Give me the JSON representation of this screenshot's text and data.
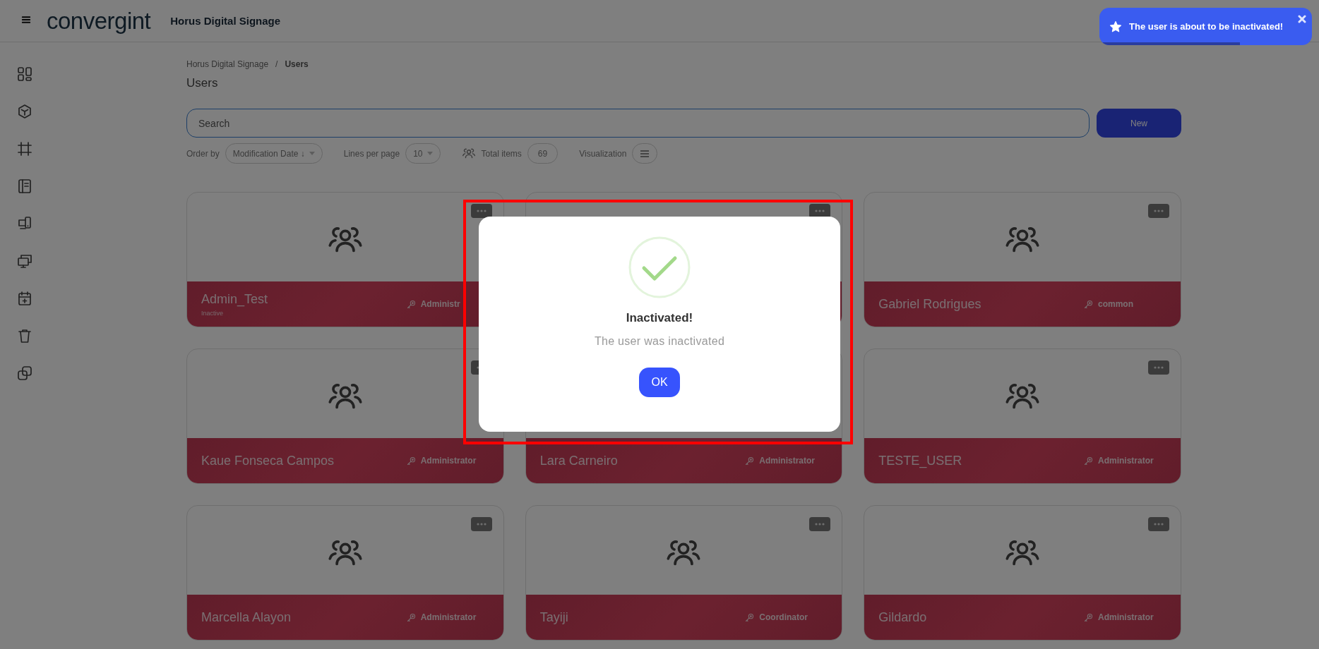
{
  "header": {
    "logo": "convergint",
    "title": "Horus Digital Signage"
  },
  "sidebar": {
    "items": [
      {
        "kind": "dashboard"
      },
      {
        "kind": "cube"
      },
      {
        "kind": "frame"
      },
      {
        "kind": "notebook"
      },
      {
        "kind": "devices"
      },
      {
        "kind": "screens"
      },
      {
        "kind": "calendar"
      },
      {
        "kind": "trash"
      },
      {
        "kind": "copy"
      }
    ]
  },
  "breadcrumb": {
    "items": [
      "Horus Digital Signage",
      "Users"
    ],
    "separator": "/"
  },
  "page_title": "Users",
  "search": {
    "placeholder": "Search"
  },
  "new_button": "New",
  "filters": {
    "order_by_label": "Order by",
    "order_by_value": "Modification Date ↓",
    "lines_label": "Lines per page",
    "lines_value": "10",
    "total_label": "Total items",
    "total_value": "69",
    "visualization_label": "Visualization"
  },
  "cards": [
    {
      "name": "Admin_Test",
      "status": "Inactive",
      "role": "Administr"
    },
    {
      "kind": "covered"
    },
    {
      "name": "Gabriel Rodrigues",
      "role": "common"
    },
    {
      "name": "Kaue Fonseca Campos",
      "role": "Administrator"
    },
    {
      "kind": "partly_covered",
      "name": "Lara Carneiro",
      "role": "Administrator"
    },
    {
      "name": "TESTE_USER",
      "role": "Administrator"
    },
    {
      "name": "Marcella Alayon",
      "role": "Administrator"
    },
    {
      "name": "Tayiji",
      "role": "Coordinator"
    },
    {
      "name": "Gildardo",
      "role": "Administrator"
    }
  ],
  "dialog": {
    "title": "Inactivated!",
    "message": "The user was inactivated",
    "ok_button": "OK"
  },
  "toast": {
    "message": "The user is about to be inactivated!",
    "level": 0.66
  }
}
